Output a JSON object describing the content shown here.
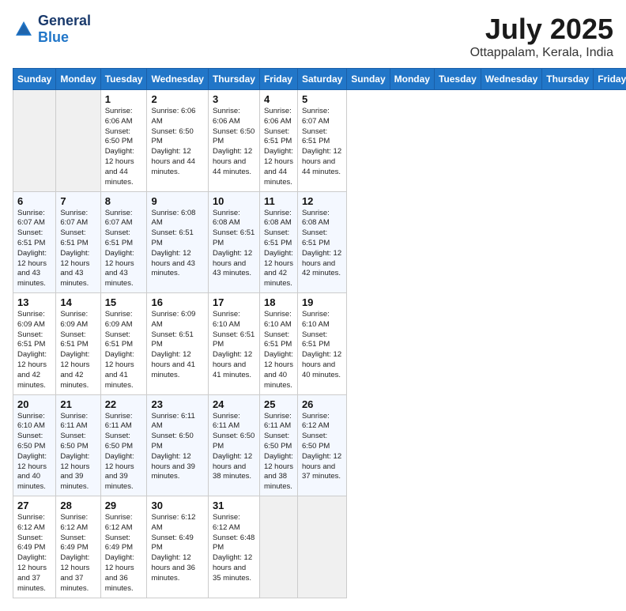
{
  "header": {
    "logo_general": "General",
    "logo_blue": "Blue",
    "month_title": "July 2025",
    "location": "Ottappalam, Kerala, India"
  },
  "calendar": {
    "days_of_week": [
      "Sunday",
      "Monday",
      "Tuesday",
      "Wednesday",
      "Thursday",
      "Friday",
      "Saturday"
    ],
    "weeks": [
      [
        {
          "day": "",
          "empty": true
        },
        {
          "day": "",
          "empty": true
        },
        {
          "day": "1",
          "sunrise": "6:06 AM",
          "sunset": "6:50 PM",
          "daylight": "12 hours and 44 minutes."
        },
        {
          "day": "2",
          "sunrise": "6:06 AM",
          "sunset": "6:50 PM",
          "daylight": "12 hours and 44 minutes."
        },
        {
          "day": "3",
          "sunrise": "6:06 AM",
          "sunset": "6:50 PM",
          "daylight": "12 hours and 44 minutes."
        },
        {
          "day": "4",
          "sunrise": "6:06 AM",
          "sunset": "6:51 PM",
          "daylight": "12 hours and 44 minutes."
        },
        {
          "day": "5",
          "sunrise": "6:07 AM",
          "sunset": "6:51 PM",
          "daylight": "12 hours and 44 minutes."
        }
      ],
      [
        {
          "day": "6",
          "sunrise": "6:07 AM",
          "sunset": "6:51 PM",
          "daylight": "12 hours and 43 minutes."
        },
        {
          "day": "7",
          "sunrise": "6:07 AM",
          "sunset": "6:51 PM",
          "daylight": "12 hours and 43 minutes."
        },
        {
          "day": "8",
          "sunrise": "6:07 AM",
          "sunset": "6:51 PM",
          "daylight": "12 hours and 43 minutes."
        },
        {
          "day": "9",
          "sunrise": "6:08 AM",
          "sunset": "6:51 PM",
          "daylight": "12 hours and 43 minutes."
        },
        {
          "day": "10",
          "sunrise": "6:08 AM",
          "sunset": "6:51 PM",
          "daylight": "12 hours and 43 minutes."
        },
        {
          "day": "11",
          "sunrise": "6:08 AM",
          "sunset": "6:51 PM",
          "daylight": "12 hours and 42 minutes."
        },
        {
          "day": "12",
          "sunrise": "6:08 AM",
          "sunset": "6:51 PM",
          "daylight": "12 hours and 42 minutes."
        }
      ],
      [
        {
          "day": "13",
          "sunrise": "6:09 AM",
          "sunset": "6:51 PM",
          "daylight": "12 hours and 42 minutes."
        },
        {
          "day": "14",
          "sunrise": "6:09 AM",
          "sunset": "6:51 PM",
          "daylight": "12 hours and 42 minutes."
        },
        {
          "day": "15",
          "sunrise": "6:09 AM",
          "sunset": "6:51 PM",
          "daylight": "12 hours and 41 minutes."
        },
        {
          "day": "16",
          "sunrise": "6:09 AM",
          "sunset": "6:51 PM",
          "daylight": "12 hours and 41 minutes."
        },
        {
          "day": "17",
          "sunrise": "6:10 AM",
          "sunset": "6:51 PM",
          "daylight": "12 hours and 41 minutes."
        },
        {
          "day": "18",
          "sunrise": "6:10 AM",
          "sunset": "6:51 PM",
          "daylight": "12 hours and 40 minutes."
        },
        {
          "day": "19",
          "sunrise": "6:10 AM",
          "sunset": "6:51 PM",
          "daylight": "12 hours and 40 minutes."
        }
      ],
      [
        {
          "day": "20",
          "sunrise": "6:10 AM",
          "sunset": "6:50 PM",
          "daylight": "12 hours and 40 minutes."
        },
        {
          "day": "21",
          "sunrise": "6:11 AM",
          "sunset": "6:50 PM",
          "daylight": "12 hours and 39 minutes."
        },
        {
          "day": "22",
          "sunrise": "6:11 AM",
          "sunset": "6:50 PM",
          "daylight": "12 hours and 39 minutes."
        },
        {
          "day": "23",
          "sunrise": "6:11 AM",
          "sunset": "6:50 PM",
          "daylight": "12 hours and 39 minutes."
        },
        {
          "day": "24",
          "sunrise": "6:11 AM",
          "sunset": "6:50 PM",
          "daylight": "12 hours and 38 minutes."
        },
        {
          "day": "25",
          "sunrise": "6:11 AM",
          "sunset": "6:50 PM",
          "daylight": "12 hours and 38 minutes."
        },
        {
          "day": "26",
          "sunrise": "6:12 AM",
          "sunset": "6:50 PM",
          "daylight": "12 hours and 37 minutes."
        }
      ],
      [
        {
          "day": "27",
          "sunrise": "6:12 AM",
          "sunset": "6:49 PM",
          "daylight": "12 hours and 37 minutes."
        },
        {
          "day": "28",
          "sunrise": "6:12 AM",
          "sunset": "6:49 PM",
          "daylight": "12 hours and 37 minutes."
        },
        {
          "day": "29",
          "sunrise": "6:12 AM",
          "sunset": "6:49 PM",
          "daylight": "12 hours and 36 minutes."
        },
        {
          "day": "30",
          "sunrise": "6:12 AM",
          "sunset": "6:49 PM",
          "daylight": "12 hours and 36 minutes."
        },
        {
          "day": "31",
          "sunrise": "6:12 AM",
          "sunset": "6:48 PM",
          "daylight": "12 hours and 35 minutes."
        },
        {
          "day": "",
          "empty": true
        },
        {
          "day": "",
          "empty": true
        }
      ]
    ]
  }
}
